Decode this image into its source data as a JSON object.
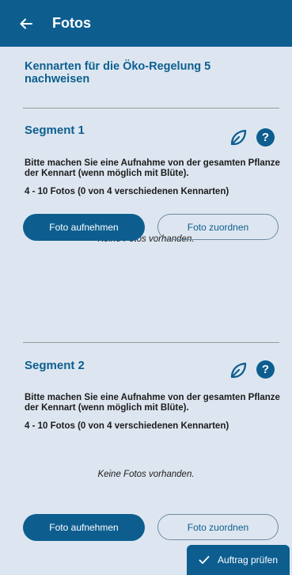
{
  "appbar": {
    "title": "Fotos",
    "back_icon": "arrow-left-icon"
  },
  "heading": "Kennarten für die Öko-Regelung 5 nachweisen",
  "segments": [
    {
      "title": "Segment 1",
      "instruction": "Bitte machen Sie eine Aufnahme von der gesamten Pflanze der Kennart (wenn möglich mit Blüte).",
      "photo_count": "4 - 10 Fotos  (0 von 4 verschiedenen Kennarten)",
      "empty_text": "Keine Fotos vorhanden.",
      "take_photo_label": "Foto aufnehmen",
      "assign_photo_label": "Foto zuordnen",
      "help_label": "?"
    },
    {
      "title": "Segment 2",
      "instruction": "Bitte machen Sie eine Aufnahme von der gesamten Pflanze der Kennart (wenn möglich mit Blüte).",
      "photo_count": "4 - 10 Fotos  (0 von 4 verschiedenen Kennarten)",
      "empty_text": "Keine Fotos vorhanden.",
      "take_photo_label": "Foto aufnehmen",
      "assign_photo_label": "Foto zuordnen",
      "help_label": "?"
    }
  ],
  "check_button": {
    "label": "Auftrag prüfen",
    "icon": "checkmark-icon"
  },
  "colors": {
    "primary": "#0d5e8f",
    "background": "#dde6f0",
    "divider": "#9a9a9a"
  }
}
